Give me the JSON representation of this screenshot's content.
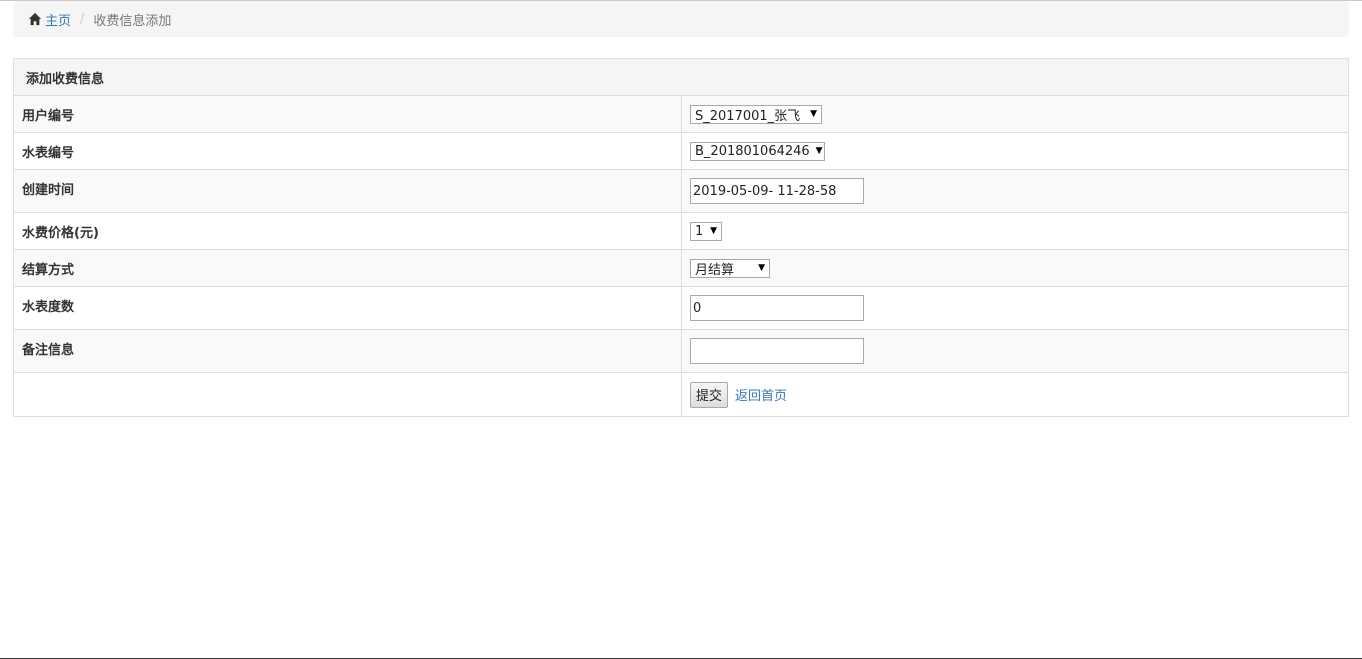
{
  "breadcrumb": {
    "home": "主页",
    "separator": "/",
    "current": "收费信息添加"
  },
  "panel": {
    "title": "添加收费信息"
  },
  "form": {
    "user_id": {
      "label": "用户编号",
      "value": "S_2017001_张飞"
    },
    "meter_id": {
      "label": "水表编号",
      "value": "B_201801064246"
    },
    "created_time": {
      "label": "创建时间",
      "value": "2019-05-09- 11-28-58"
    },
    "price": {
      "label": "水费价格(元)",
      "value": "1"
    },
    "settlement": {
      "label": "结算方式",
      "value": "月结算"
    },
    "reading": {
      "label": "水表度数",
      "value": "0"
    },
    "remark": {
      "label": "备注信息",
      "value": ""
    },
    "submit_label": "提交",
    "back_label": "返回首页"
  },
  "icons": {
    "home": "home-icon",
    "caret": "caret-down-icon"
  },
  "colors": {
    "link": "#337ab7",
    "breadcrumb_bg": "#f5f5f5",
    "border": "#dddddd"
  }
}
